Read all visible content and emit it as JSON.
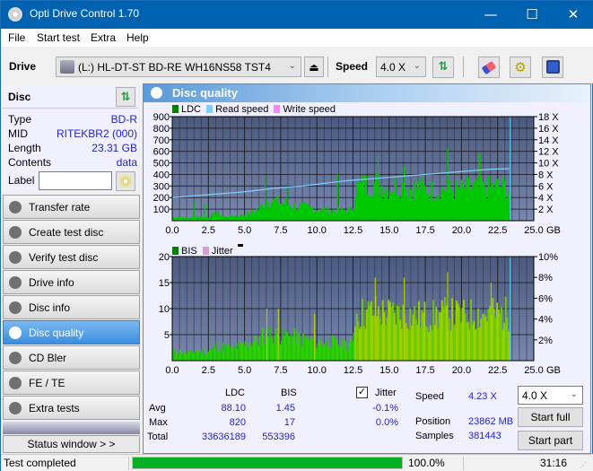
{
  "window": {
    "title": "Opti Drive Control 1.70",
    "minimize": "—",
    "maximize": "☐",
    "close": "✕"
  },
  "menu": [
    "File",
    "Start test",
    "Extra",
    "Help"
  ],
  "toolbar": {
    "drive_label": "Drive",
    "drive_value": "(L:)  HL-DT-ST BD-RE  WH16NS58 TST4",
    "speed_label": "Speed",
    "speed_value": "4.0 X"
  },
  "disc": {
    "header": "Disc",
    "rows": [
      {
        "key": "Type",
        "value": "BD-R"
      },
      {
        "key": "MID",
        "value": "RITEKBR2 (000)"
      },
      {
        "key": "Length",
        "value": "23.31 GB"
      },
      {
        "key": "Contents",
        "value": "data"
      }
    ],
    "label_key": "Label",
    "label_value": ""
  },
  "nav": [
    {
      "label": "Transfer rate",
      "active": false
    },
    {
      "label": "Create test disc",
      "active": false
    },
    {
      "label": "Verify test disc",
      "active": false
    },
    {
      "label": "Drive info",
      "active": false
    },
    {
      "label": "Disc info",
      "active": false
    },
    {
      "label": "Disc quality",
      "active": true
    },
    {
      "label": "CD Bler",
      "active": false
    },
    {
      "label": "FE / TE",
      "active": false
    },
    {
      "label": "Extra tests",
      "active": false
    }
  ],
  "status_window_btn": "Status window > >",
  "panel_title": "Disc quality",
  "stats": {
    "col_ldc": "LDC",
    "col_bis": "BIS",
    "jitter_label": "Jitter",
    "jitter_checked": true,
    "rows": [
      {
        "label": "Avg",
        "ldc": "88.10",
        "bis": "1.45",
        "jitter": "-0.1%"
      },
      {
        "label": "Max",
        "ldc": "820",
        "bis": "17",
        "jitter": "0.0%"
      },
      {
        "label": "Total",
        "ldc": "33636189",
        "bis": "553396",
        "jitter": ""
      }
    ],
    "speed_label": "Speed",
    "speed_value": "4.23 X",
    "position_label": "Position",
    "position_value": "23862 MB",
    "samples_label": "Samples",
    "samples_value": "381443",
    "speed_select": "4.0 X",
    "start_full": "Start full",
    "start_part": "Start part"
  },
  "statusbar": {
    "text": "Test completed",
    "progress": 100.0,
    "progress_text": "100.0%",
    "time": "31:16"
  },
  "colors": {
    "ldc": "#00c800",
    "read_speed": "#80d0ff",
    "write_speed": "#ff80ff",
    "bis": "#00c800",
    "jitter": "#d0a0d0",
    "plot_bg_top": "#4a5a80",
    "plot_bg_bottom": "#7888b0",
    "progress": "#06b025"
  },
  "chart_data": [
    {
      "type": "area",
      "title": "LDC / Read speed",
      "legend": [
        "LDC",
        "Read speed",
        "Write speed"
      ],
      "xlabel": "GB",
      "xlim": [
        0,
        25
      ],
      "xticks": [
        "0.0",
        "2.5",
        "5.0",
        "7.5",
        "10.0",
        "12.5",
        "15.0",
        "17.5",
        "20.0",
        "22.5",
        "25.0"
      ],
      "ylim": [
        0,
        900
      ],
      "yticks": [
        "100",
        "200",
        "300",
        "400",
        "500",
        "600",
        "700",
        "800",
        "900"
      ],
      "y2lim": [
        0,
        18
      ],
      "y2ticks": [
        "2 X",
        "4 X",
        "6 X",
        "8 X",
        "10 X",
        "12 X",
        "14 X",
        "16 X",
        "18 X"
      ],
      "end_marker_gb": 23.31,
      "ldc_series": {
        "name": "LDC",
        "x": [
          0,
          0.5,
          1,
          1.5,
          2,
          2.5,
          3,
          3.5,
          4,
          4.5,
          5,
          5.5,
          6,
          6.5,
          7,
          7.5,
          8,
          8.5,
          9,
          9.5,
          10,
          10.5,
          11,
          11.5,
          12,
          12.4,
          12.6,
          13,
          13.5,
          14,
          14.5,
          15,
          15.5,
          16,
          16.5,
          17,
          17.5,
          18,
          18.5,
          19,
          19.5,
          20,
          20.5,
          21,
          21.5,
          22,
          22.5,
          23,
          23.3
        ],
        "y": [
          30,
          40,
          25,
          45,
          40,
          35,
          80,
          40,
          45,
          50,
          60,
          90,
          120,
          200,
          180,
          170,
          160,
          140,
          130,
          120,
          110,
          100,
          95,
          100,
          100,
          105,
          320,
          330,
          350,
          360,
          330,
          320,
          340,
          330,
          310,
          320,
          300,
          290,
          300,
          310,
          290,
          300,
          320,
          310,
          300,
          320,
          330,
          320,
          300
        ]
      },
      "ldc_spikes": [
        {
          "x": 1.5,
          "y": 160
        },
        {
          "x": 2.2,
          "y": 150
        },
        {
          "x": 6.4,
          "y": 390
        },
        {
          "x": 7.9,
          "y": 290
        },
        {
          "x": 11.4,
          "y": 400
        },
        {
          "x": 14.2,
          "y": 560
        },
        {
          "x": 16.0,
          "y": 470
        },
        {
          "x": 19.0,
          "y": 630
        },
        {
          "x": 21.2,
          "y": 580
        },
        {
          "x": 22.9,
          "y": 370
        }
      ],
      "read_speed_series": {
        "name": "Read speed",
        "x": [
          0,
          1,
          2,
          3,
          4,
          5,
          6,
          7,
          8,
          9,
          10,
          11,
          12,
          12.5,
          13,
          14,
          15,
          16,
          17,
          18,
          19,
          20,
          21,
          22,
          23.3
        ],
        "y": [
          4.0,
          4.2,
          4.4,
          4.6,
          4.8,
          5.0,
          5.3,
          5.6,
          5.8,
          6.0,
          6.3,
          6.6,
          6.9,
          7.0,
          7.1,
          7.3,
          7.5,
          7.7,
          7.9,
          8.1,
          8.3,
          8.5,
          8.7,
          8.9,
          9.0
        ]
      }
    },
    {
      "type": "area",
      "title": "BIS / Jitter",
      "legend": [
        "BIS",
        "Jitter"
      ],
      "xlabel": "GB",
      "xlim": [
        0,
        25
      ],
      "xticks": [
        "0.0",
        "2.5",
        "5.0",
        "7.5",
        "10.0",
        "12.5",
        "15.0",
        "17.5",
        "20.0",
        "22.5",
        "25.0"
      ],
      "ylim": [
        0,
        20
      ],
      "yticks": [
        "5",
        "10",
        "15",
        "20"
      ],
      "y2lim": [
        0,
        10
      ],
      "y2ticks": [
        "2%",
        "4%",
        "6%",
        "8%",
        "10%"
      ],
      "end_marker_gb": 23.31,
      "bis_series": {
        "name": "BIS",
        "x": [
          0,
          0.5,
          1,
          1.5,
          2,
          2.5,
          3,
          3.5,
          4,
          4.5,
          5,
          5.5,
          6,
          6.5,
          7,
          7.5,
          8,
          8.5,
          9,
          9.5,
          10,
          10.5,
          11,
          11.5,
          12,
          12.4,
          12.6,
          13,
          14,
          15,
          16,
          17,
          18,
          19,
          20,
          21,
          22,
          23,
          23.3
        ],
        "y": [
          2,
          2,
          1.5,
          2,
          2,
          2,
          3,
          3,
          2.5,
          3,
          3.5,
          4,
          4.5,
          6,
          5.5,
          5,
          5.5,
          5,
          4.5,
          4.5,
          4,
          4,
          4,
          3.5,
          3.5,
          3.5,
          10,
          10,
          10.5,
          10,
          10,
          9.5,
          9.5,
          10,
          9.5,
          10,
          10,
          10,
          10
        ]
      },
      "bis_spikes": [
        {
          "x": 6.5,
          "y": 10
        },
        {
          "x": 7.3,
          "y": 10
        },
        {
          "x": 9.8,
          "y": 9
        },
        {
          "x": 14.0,
          "y": 16
        },
        {
          "x": 16.0,
          "y": 16
        },
        {
          "x": 19.0,
          "y": 17
        },
        {
          "x": 22.0,
          "y": 15
        }
      ]
    }
  ]
}
